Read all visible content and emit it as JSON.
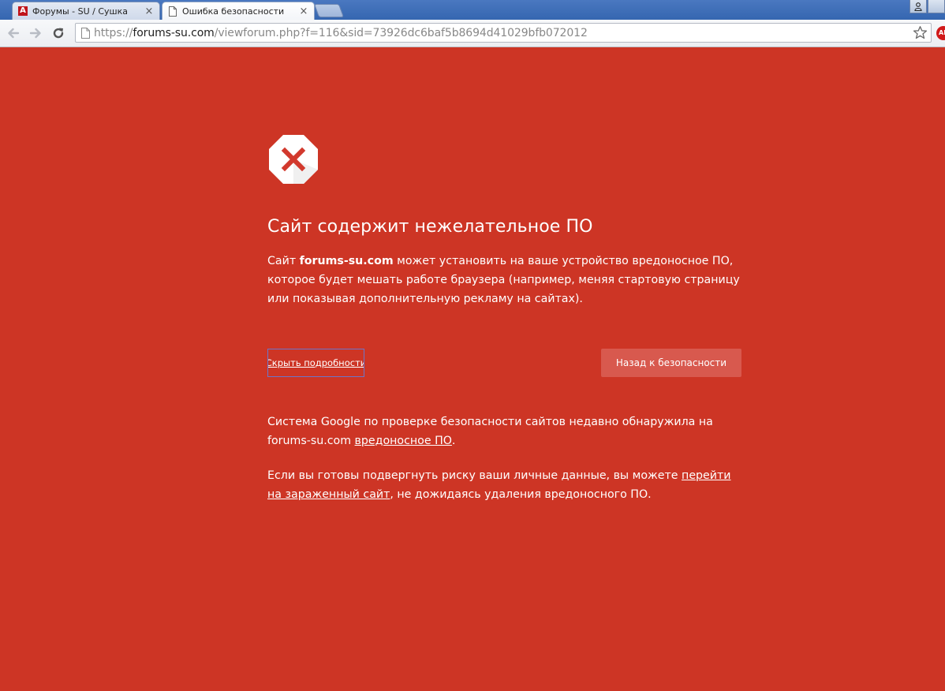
{
  "browser": {
    "tabs": [
      {
        "title": "Форумы - SU / Сушка",
        "favicon": "opera-icon",
        "favicon_letter": "A",
        "active": false
      },
      {
        "title": "Ошибка безопасности",
        "favicon": "page-icon",
        "active": true
      }
    ],
    "close_glyph": "×",
    "address": {
      "scheme": "https://",
      "host": "forums-su.com",
      "path": "/viewforum.php?f=116&sid=73926dc6baf5b8694d41029bfb072012"
    },
    "extension_badge_text": "ABP"
  },
  "interstitial": {
    "heading": "Сайт содержит нежелательное ПО",
    "main_message": {
      "prefix": "Сайт ",
      "site": "forums-su.com",
      "suffix": " может установить на ваше устройство вредоносное ПО, которое будет мешать работе браузера (например, меняя стартовую страницу или показывая дополнительную рекламу на сайтах)."
    },
    "details_button_label": "Скрыть подробности",
    "primary_button_label": "Назад к безопасности",
    "details_paragraph_1": {
      "text": "Система Google по проверке безопасности сайтов недавно обнаружила на forums-su.com ",
      "link": "вредоносное ПО",
      "suffix": "."
    },
    "details_paragraph_2": {
      "prefix": "Если вы готовы подвергнуть риску ваши личные данные, вы можете ",
      "link": "перейти на зараженный сайт",
      "suffix": ", не дожидаясь удаления вредоносного ПО."
    }
  },
  "colors": {
    "page_background": "#cd3525",
    "primary_button": "#d8594e",
    "details_button_border": "#6b75c9",
    "warning_x": "#d2392d"
  }
}
